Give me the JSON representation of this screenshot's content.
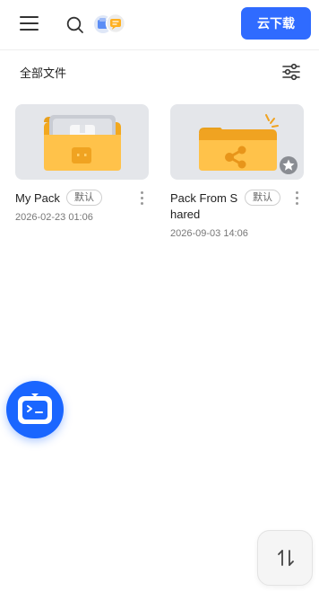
{
  "header": {
    "menu_icon": "hamburger-menu-icon",
    "search_icon": "search-icon",
    "apps_icon": "stacked-app-icons",
    "cloud_download_label": "云下载",
    "accent_color": "#2f6bff"
  },
  "files": {
    "section_title": "全部文件",
    "filter_icon": "sliders-filter-icon",
    "items": [
      {
        "name": "My Pack",
        "badge": "默认",
        "date": "2026-02-23 01:06",
        "thumbnail_icon": "pack-folder-icon"
      },
      {
        "name_line1": "Pack From S",
        "name_line2": "hared",
        "badge": "默认",
        "date": "2026-09-03 14:06",
        "thumbnail_icon": "shared-folder-icon",
        "corner_icon": "star-icon"
      }
    ]
  },
  "floating": {
    "assistant_icon": "robot-assistant-icon",
    "sort_icon": "sort-arrows-icon"
  }
}
